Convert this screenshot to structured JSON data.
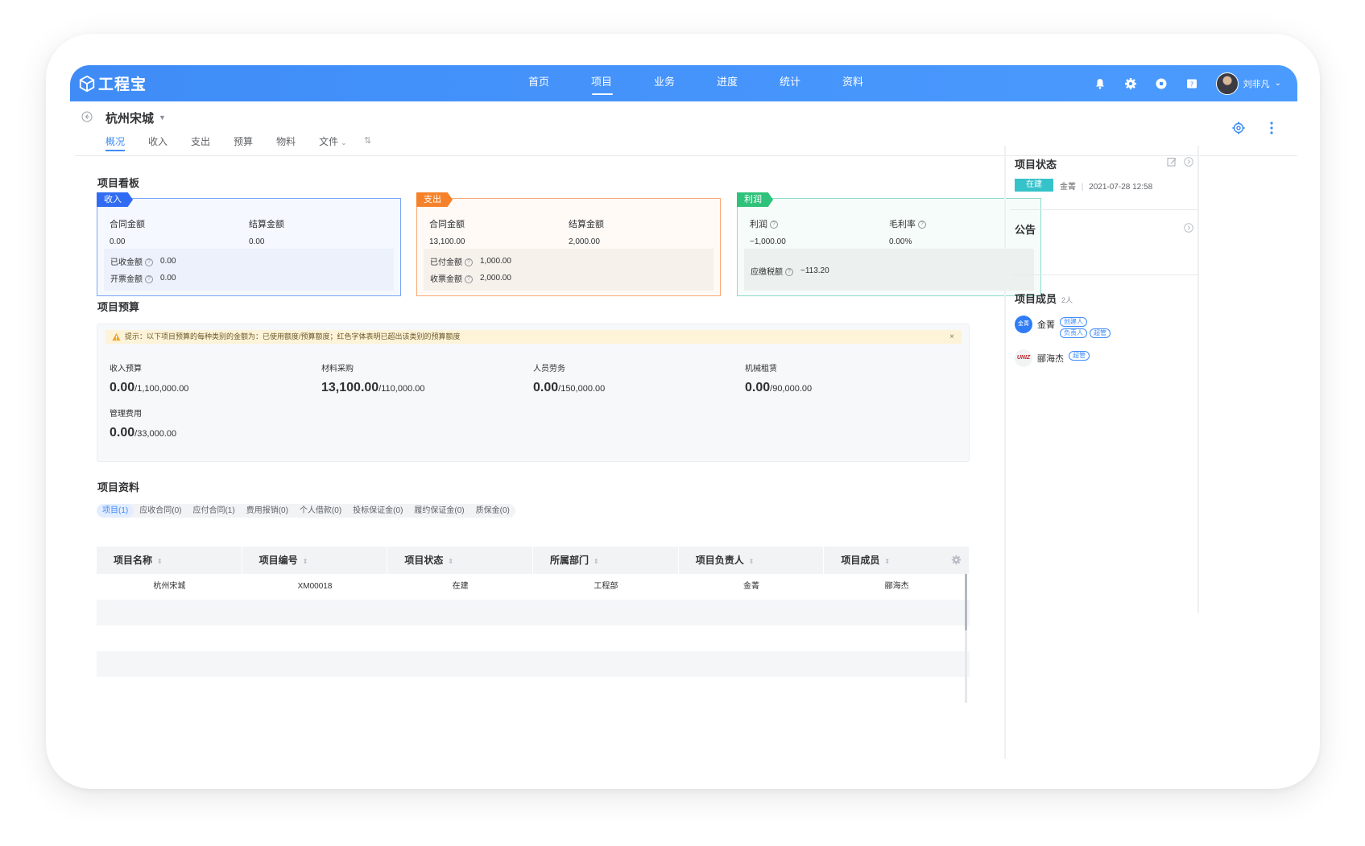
{
  "app": {
    "logo_text": "工程宝",
    "user_name": "刘非凡"
  },
  "nav": [
    "首页",
    "项目",
    "业务",
    "进度",
    "统计",
    "资料"
  ],
  "project": {
    "title": "杭州宋城",
    "tabs": [
      "概况",
      "收入",
      "支出",
      "预算",
      "物料",
      "文件"
    ]
  },
  "board": {
    "title": "项目看板",
    "income": {
      "tag": "收入",
      "color": "#2f6cf3",
      "contract_label": "合同金额",
      "contract_value": "0.00",
      "settle_label": "结算金额",
      "settle_value": "0.00",
      "received_label": "已收金额",
      "received_value": "0.00",
      "invoiced_label": "开票金额",
      "invoiced_value": "0.00"
    },
    "expense": {
      "tag": "支出",
      "color": "#f5822a",
      "contract_label": "合同金额",
      "contract_value": "13,100.00",
      "settle_label": "结算金额",
      "settle_value": "2,000.00",
      "paid_label": "已付金额",
      "paid_value": "1,000.00",
      "ticket_label": "收票金额",
      "ticket_value": "2,000.00"
    },
    "profit": {
      "tag": "利润",
      "color": "#2fc27a",
      "profit_label": "利润",
      "profit_value": "−1,000.00",
      "margin_label": "毛利率",
      "margin_value": "0.00%",
      "tax_label": "应缴税额",
      "tax_value": "−113.20"
    }
  },
  "budget": {
    "title": "项目预算",
    "tip": "提示：以下项目预算的每种类别的金额为：已使用额度/预算额度；红色字体表明已超出该类别的预算额度",
    "close": "×",
    "items": [
      {
        "label": "收入预算",
        "used": "0.00",
        "total": "/1,100,000.00"
      },
      {
        "label": "材料采购",
        "used": "13,100.00",
        "total": "/110,000.00"
      },
      {
        "label": "人员劳务",
        "used": "0.00",
        "total": "/150,000.00"
      },
      {
        "label": "机械租赁",
        "used": "0.00",
        "total": "/90,000.00"
      },
      {
        "label": "管理费用",
        "used": "0.00",
        "total": "/33,000.00"
      }
    ]
  },
  "materials": {
    "title": "项目资料",
    "tabs": [
      "项目(1)",
      "应收合同(0)",
      "应付合同(1)",
      "费用报销(0)",
      "个人借款(0)",
      "投标保证金(0)",
      "履约保证金(0)",
      "质保金(0)"
    ]
  },
  "table": {
    "headers": [
      "项目名称",
      "项目编号",
      "项目状态",
      "所属部门",
      "项目负责人",
      "项目成员"
    ],
    "sort_glyph": "⇕",
    "rows": [
      [
        "杭州宋城",
        "XM00018",
        "在建",
        "工程部",
        "金菁",
        "郦海杰"
      ]
    ]
  },
  "side": {
    "status_title": "项目状态",
    "status_badge": "在建",
    "status_user": "金菁",
    "status_sep": "|",
    "status_time": "2021-07-28 12:58",
    "notice_title": "公告",
    "members_title": "项目成员",
    "members_count": "2人",
    "members": [
      {
        "avatar_text": "金菁",
        "name": "金菁",
        "badges": [
          "创建人",
          "负责人",
          "超管"
        ]
      },
      {
        "avatar_text": "UNIZ",
        "name": "郦海杰",
        "badges": [
          "超管"
        ]
      }
    ]
  }
}
